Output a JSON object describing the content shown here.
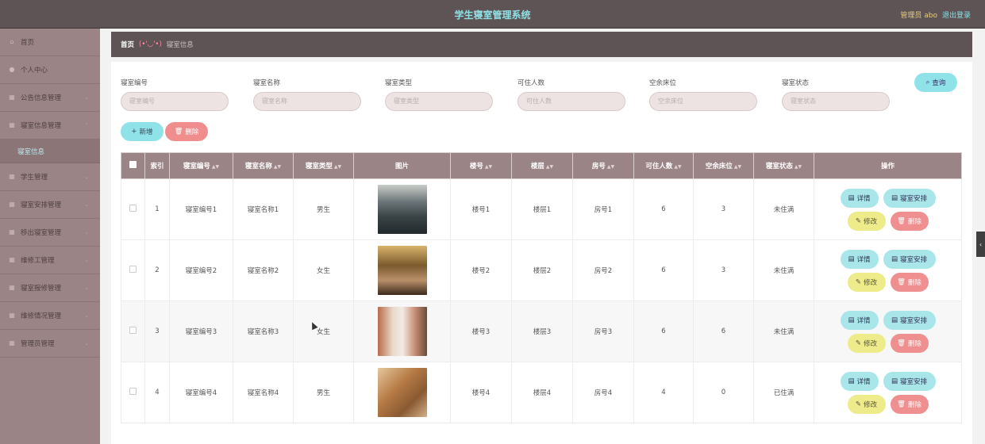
{
  "header": {
    "title": "学生寝室管理系统",
    "admin": "管理员 abo",
    "logout": "退出登录"
  },
  "sidebar": {
    "items": [
      {
        "label": "首页",
        "icon": "home-icon"
      },
      {
        "label": "个人中心",
        "icon": "user-icon"
      },
      {
        "label": "公告信息管理",
        "icon": "grid-icon"
      },
      {
        "label": "寝室信息管理",
        "icon": "grid-icon"
      },
      {
        "label": "学生管理",
        "icon": "grid-icon"
      },
      {
        "label": "寝室安排管理",
        "icon": "grid-icon"
      },
      {
        "label": "移出寝室管理",
        "icon": "grid-icon"
      },
      {
        "label": "维修工管理",
        "icon": "grid-icon"
      },
      {
        "label": "寝室报修管理",
        "icon": "grid-icon"
      },
      {
        "label": "维修情况管理",
        "icon": "grid-icon"
      },
      {
        "label": "管理员管理",
        "icon": "grid-icon"
      }
    ],
    "active_sub": "寝室信息"
  },
  "breadcrumb": {
    "home": "首页",
    "sep": "(•'◡'•)",
    "current": "寝室信息"
  },
  "search": {
    "fields": [
      {
        "label": "寝室编号",
        "placeholder": "寝室编号"
      },
      {
        "label": "寝室名称",
        "placeholder": "寝室名称"
      },
      {
        "label": "寝室类型",
        "placeholder": "寝室类型"
      },
      {
        "label": "可住人数",
        "placeholder": "可住人数"
      },
      {
        "label": "空余床位",
        "placeholder": "空余床位"
      },
      {
        "label": "寝室状态",
        "placeholder": "寝室状态"
      }
    ],
    "query": "查询"
  },
  "actions": {
    "add": "新增",
    "delete": "删除"
  },
  "table": {
    "headers": [
      "索引",
      "寝室编号",
      "寝室名称",
      "寝室类型",
      "图片",
      "楼号",
      "楼层",
      "房号",
      "可住人数",
      "空余床位",
      "寝室状态",
      "操作"
    ],
    "rows": [
      {
        "index": "1",
        "code": "寝室编号1",
        "name": "寝室名称1",
        "type": "男生",
        "building": "楼号1",
        "floor": "楼层1",
        "room": "房号1",
        "capacity": "6",
        "free": "3",
        "status": "未住满",
        "img_color": "#5a6166"
      },
      {
        "index": "2",
        "code": "寝室编号2",
        "name": "寝室名称2",
        "type": "女生",
        "building": "楼号2",
        "floor": "楼层2",
        "room": "房号2",
        "capacity": "6",
        "free": "3",
        "status": "未住满",
        "img_color": "#8a6a3a"
      },
      {
        "index": "3",
        "code": "寝室编号3",
        "name": "寝室名称3",
        "type": "女生",
        "building": "楼号3",
        "floor": "楼层3",
        "room": "房号3",
        "capacity": "6",
        "free": "6",
        "status": "未住满",
        "img_color": "#a07a60"
      },
      {
        "index": "4",
        "code": "寝室编号4",
        "name": "寝室名称4",
        "type": "男生",
        "building": "楼号4",
        "floor": "楼层4",
        "room": "房号4",
        "capacity": "4",
        "free": "0",
        "status": "已住满",
        "img_color": "#9a6a3c"
      }
    ],
    "ops": {
      "detail": "详情",
      "arrange": "寝室安排",
      "edit": "修改",
      "remove": "删除"
    }
  }
}
